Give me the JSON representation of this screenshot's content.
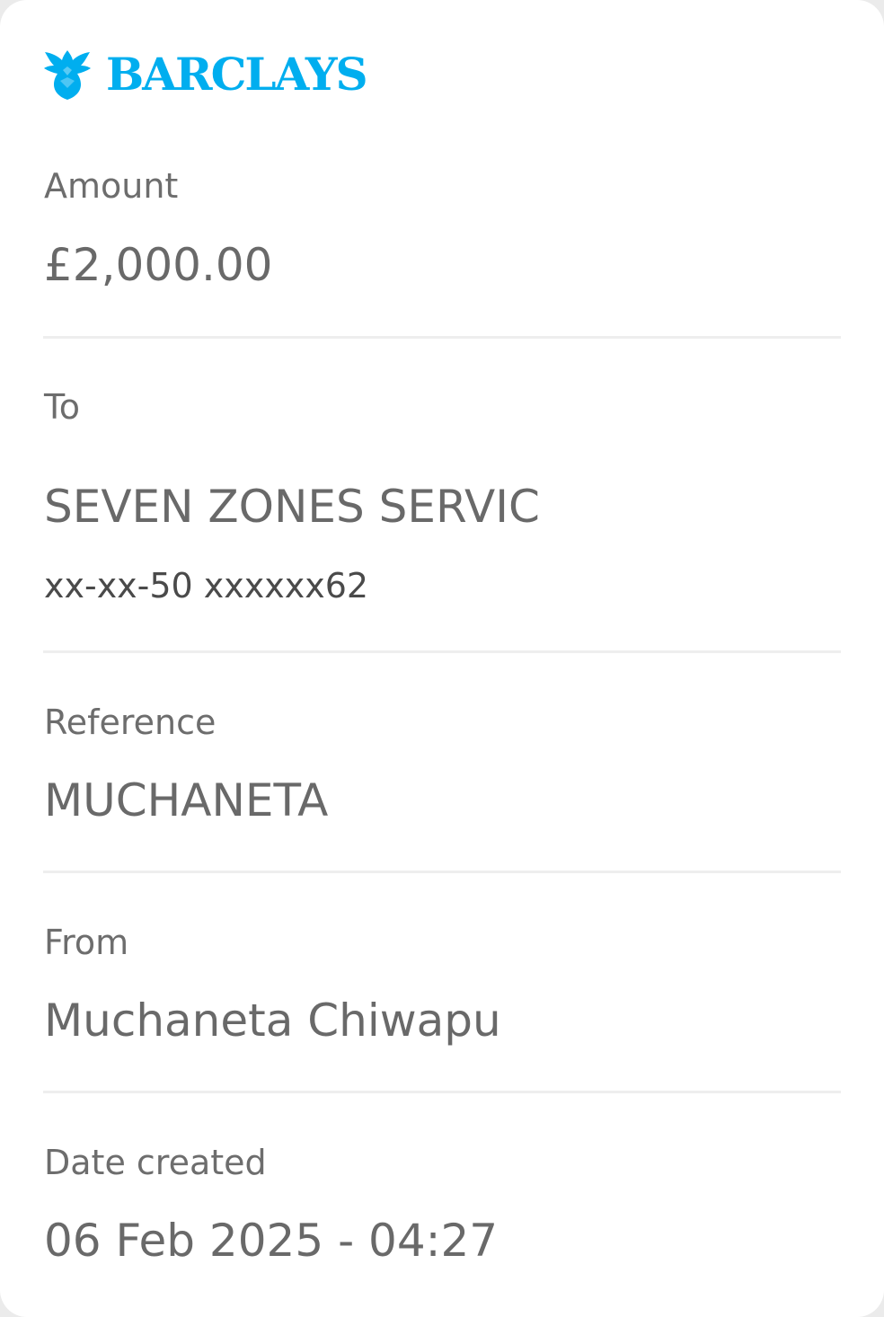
{
  "brand": {
    "name": "BARCLAYS",
    "color": "#00aeef",
    "icon": "eagle-icon"
  },
  "amount": {
    "label": "Amount",
    "value": "£2,000.00"
  },
  "to": {
    "label": "To",
    "name": "SEVEN ZONES SERVIC",
    "account": "xx-xx-50 xxxxxx62"
  },
  "reference": {
    "label": "Reference",
    "value": "MUCHANETA"
  },
  "from": {
    "label": "From",
    "value": "Muchaneta Chiwapu"
  },
  "date_created": {
    "label": "Date created",
    "value": "06 Feb 2025 - 04:27"
  }
}
